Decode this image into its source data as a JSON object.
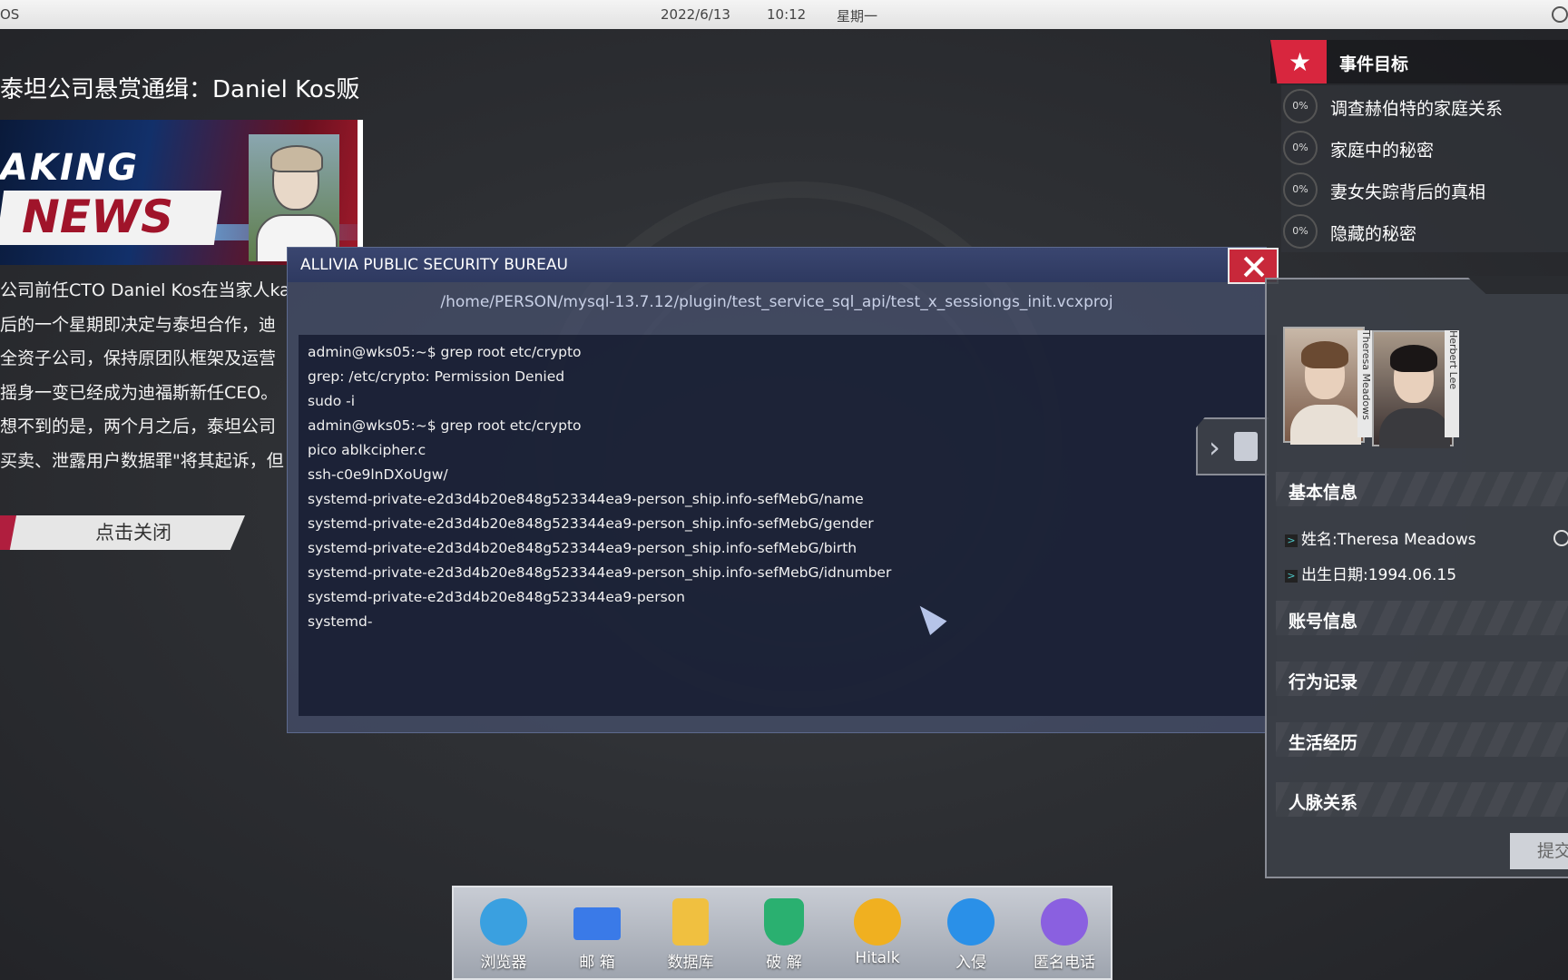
{
  "topbar": {
    "os_label": "OS",
    "date": "2022/6/13",
    "time": "10:12",
    "weekday": "星期一"
  },
  "news": {
    "title": "泰坦公司悬赏通缉：Daniel Kos贩",
    "banner_line1": "AKING",
    "banner_line2": "NEWS",
    "body_lines": [
      "公司前任CTO Daniel Kos在当家人kap",
      "后的一个星期即决定与泰坦合作，迪",
      "全资子公司，保持原团队框架及运营",
      "摇身一变已经成为迪福斯新任CEO。",
      "想不到的是，两个月之后，泰坦公司",
      "买卖、泄露用户数据罪\"将其起诉，但"
    ],
    "close_label": "点击关闭"
  },
  "terminal": {
    "title": "ALLIVIA PUBLIC SECURITY BUREAU",
    "path": "/home/PERSON/mysql-13.7.12/plugin/test_service_sql_api/test_x_sessiongs_init.vcxproj",
    "lines": [
      "admin@wks05:~$ grep root etc/crypto",
      "grep: /etc/crypto: Permission Denied",
      "sudo -i",
      "admin@wks05:~$ grep root etc/crypto",
      "pico ablkcipher.c",
      "ssh-c0e9lnDXoUgw/",
      "systemd-private-e2d3d4b20e848g523344ea9-person_ship.info-sefMebG/name",
      "systemd-private-e2d3d4b20e848g523344ea9-person_ship.info-sefMebG/gender",
      "systemd-private-e2d3d4b20e848g523344ea9-person_ship.info-sefMebG/birth",
      "systemd-private-e2d3d4b20e848g523344ea9-person_ship.info-sefMebG/idnumber",
      "systemd-private-e2d3d4b20e848g523344ea9-person",
      "systemd-"
    ]
  },
  "objectives": {
    "header": "事件目标",
    "items": [
      {
        "percent": "0%",
        "label": "调查赫伯特的家庭关系"
      },
      {
        "percent": "0%",
        "label": "家庭中的秘密"
      },
      {
        "percent": "0%",
        "label": "妻女失踪背后的真相"
      },
      {
        "percent": "0%",
        "label": "隐藏的秘密"
      }
    ]
  },
  "profile": {
    "people": [
      "Theresa Meadows",
      "Herbert Lee"
    ],
    "sections": {
      "basic": "基本信息",
      "account": "账号信息",
      "behavior": "行为记录",
      "life": "生活经历",
      "network": "人脉关系"
    },
    "fields": {
      "name": "姓名:Theresa Meadows",
      "birth": "出生日期:1994.06.15"
    },
    "submit_label": "提交"
  },
  "dock": {
    "items": [
      {
        "label": "浏览器",
        "color": "#3aa0e0"
      },
      {
        "label": "邮 箱",
        "color": "#3a7ae8"
      },
      {
        "label": "数据库",
        "color": "#f0c040"
      },
      {
        "label": "破 解",
        "color": "#2ab070"
      },
      {
        "label": "Hitalk",
        "color": "#f0b020"
      },
      {
        "label": "入侵",
        "color": "#2a90e8"
      },
      {
        "label": "匿名电话",
        "color": "#8a60e0"
      }
    ]
  }
}
